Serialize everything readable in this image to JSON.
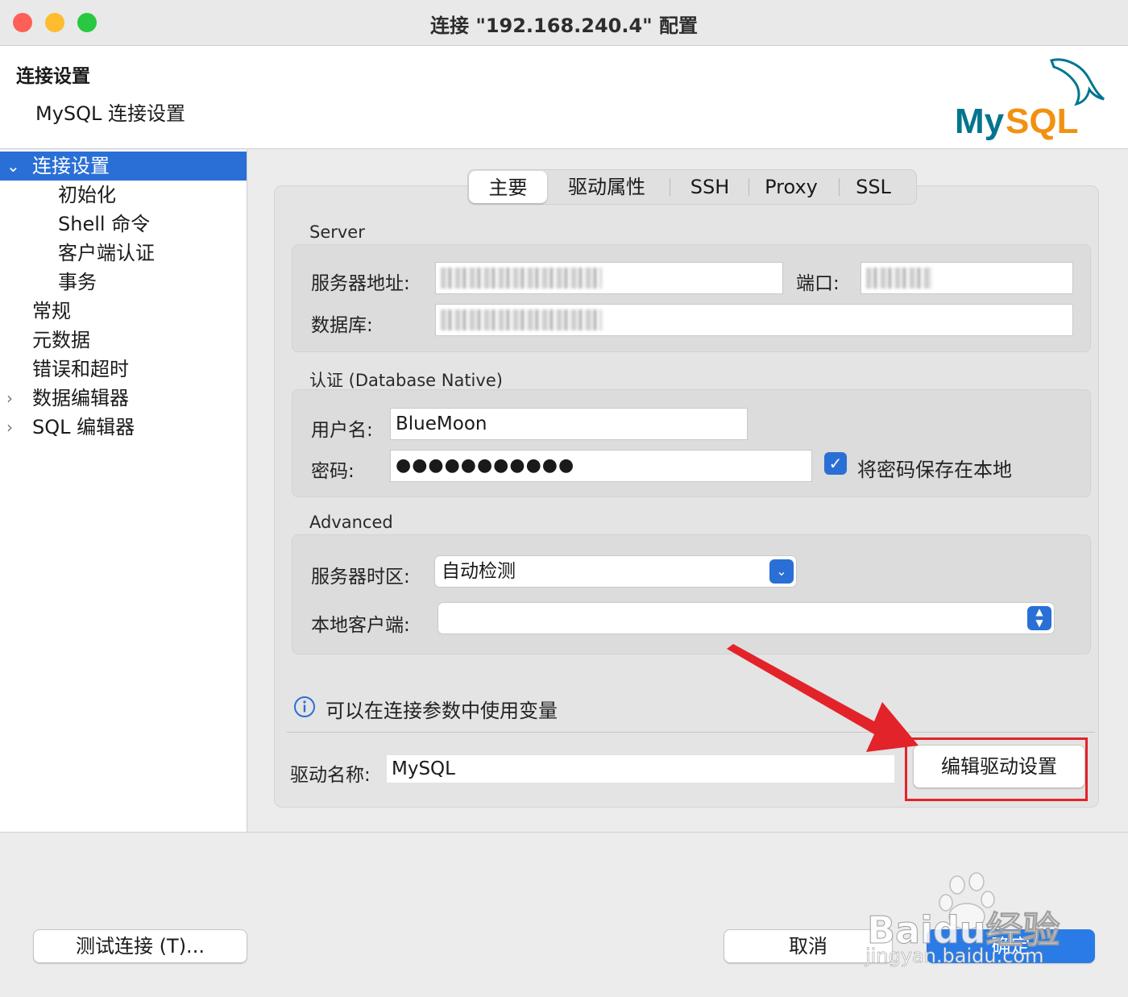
{
  "window": {
    "title": "连接 \"192.168.240.4\" 配置"
  },
  "header": {
    "title": "连接设置",
    "subtitle": "MySQL 连接设置",
    "logo_text": "MySQL"
  },
  "sidebar": {
    "items": [
      {
        "label": "连接设置"
      },
      {
        "label": "初始化"
      },
      {
        "label": "Shell 命令"
      },
      {
        "label": "客户端认证"
      },
      {
        "label": "事务"
      },
      {
        "label": "常规"
      },
      {
        "label": "元数据"
      },
      {
        "label": "错误和超时"
      },
      {
        "label": "数据编辑器"
      },
      {
        "label": "SQL 编辑器"
      }
    ]
  },
  "tabs": [
    {
      "label": "主要"
    },
    {
      "label": "驱动属性"
    },
    {
      "label": "SSH"
    },
    {
      "label": "Proxy"
    },
    {
      "label": "SSL"
    }
  ],
  "server": {
    "section_label": "Server",
    "host_label": "服务器地址:",
    "port_label": "端口:",
    "database_label": "数据库:"
  },
  "auth": {
    "section_label": "认证 (Database Native)",
    "username_label": "用户名:",
    "username_value": "BlueMoon",
    "password_label": "密码:",
    "password_value": "●●●●●●●●●●●",
    "save_password_label": "将密码保存在本地"
  },
  "advanced": {
    "section_label": "Advanced",
    "timezone_label": "服务器时区:",
    "timezone_value": "自动检测",
    "local_client_label": "本地客户端:",
    "local_client_value": ""
  },
  "info": {
    "text": "可以在连接参数中使用变量"
  },
  "driver": {
    "name_label": "驱动名称:",
    "name_value": "MySQL",
    "edit_button": "编辑驱动设置"
  },
  "footer": {
    "test_button": "测试连接 (T)...",
    "cancel_button": "取消",
    "ok_button": "确定"
  },
  "watermark": {
    "brand": "Baidu经验",
    "url": "jingyan.baidu.com"
  },
  "colors": {
    "accent": "#2a6fd6",
    "highlight": "#e3232a",
    "mysql_teal": "#00758f",
    "mysql_orange": "#f29111"
  }
}
